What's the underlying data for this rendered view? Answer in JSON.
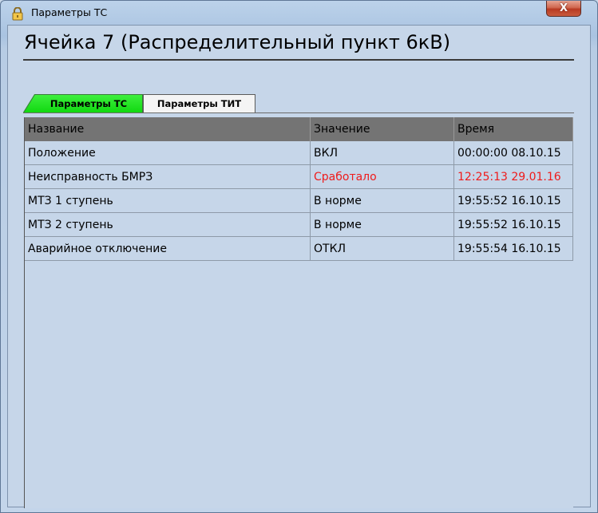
{
  "window": {
    "title": "Параметры ТС",
    "close_label": "X",
    "colors": {
      "active_tab": "#18e018",
      "alarm_text": "#ef1b1b",
      "header_bg": "#747474"
    }
  },
  "main": {
    "heading": "Ячейка 7 (Распределительный пункт 6кВ)",
    "tabs": [
      {
        "label": "Параметры ТС",
        "active": true
      },
      {
        "label": "Параметры ТИТ",
        "active": false
      }
    ],
    "table": {
      "columns": [
        "Название",
        "Значение",
        "Время"
      ],
      "rows": [
        {
          "name": "Положение",
          "value": "ВКЛ",
          "time": "00:00:00 08.10.15",
          "alarm": false
        },
        {
          "name": "Неисправность БМРЗ",
          "value": "Сработало",
          "time": "12:25:13 29.01.16",
          "alarm": true
        },
        {
          "name": "МТЗ 1 ступень",
          "value": "В норме",
          "time": "19:55:52 16.10.15",
          "alarm": false
        },
        {
          "name": "МТЗ 2 ступень",
          "value": "В норме",
          "time": "19:55:52 16.10.15",
          "alarm": false
        },
        {
          "name": "Аварийное отключение",
          "value": "ОТКЛ",
          "time": "19:55:54 16.10.15",
          "alarm": false
        }
      ]
    }
  }
}
